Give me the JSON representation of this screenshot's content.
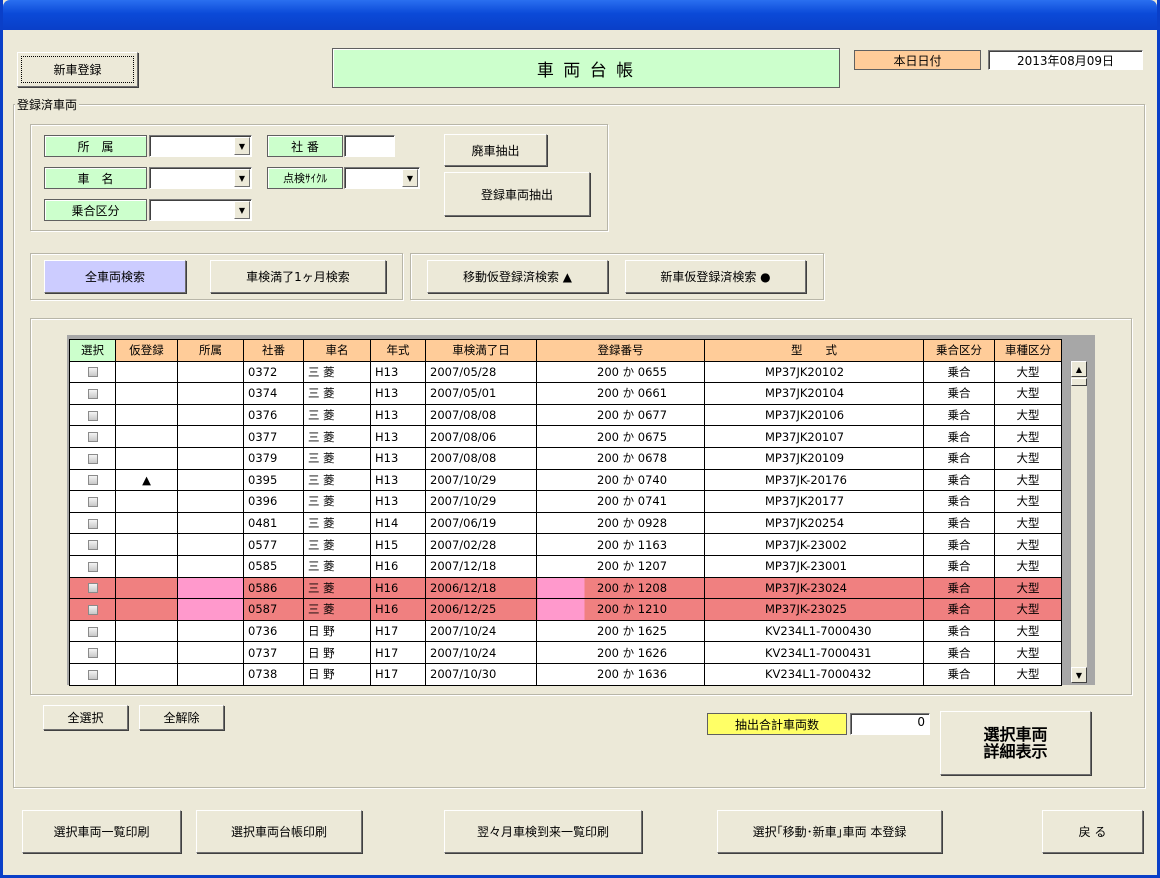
{
  "title": {
    "main": "車 両 台 帳",
    "today_label": "本日日付",
    "today_value": "2013年08月09日"
  },
  "buttons": {
    "new_car": "新車登録",
    "scrapped_extract": "廃車抽出",
    "registered_extract": "登録車両抽出",
    "all_search": "全車両検索",
    "inspection_month_search": "車検満了1ヶ月検索",
    "transfer_provisional_search": "移動仮登録済検索 ▲",
    "new_provisional_search": "新車仮登録済検索 ●",
    "select_all": "全選択",
    "deselect_all": "全解除",
    "detail_line1": "選択車両",
    "detail_line2": "詳細表示",
    "print_list": "選択車両一覧印刷",
    "print_ledger": "選択車両台帳印刷",
    "print_next_inspection": "翌々月車検到来一覧印刷",
    "register_selected": "選択｢移動･新車｣車両 本登録",
    "back": "戻 る"
  },
  "filters": {
    "group_caption": "登録済車両",
    "affiliation_label": "所　属",
    "car_name_label": "車　名",
    "riding_class_label": "乗合区分",
    "company_no_label": "社 番",
    "inspection_cycle_label": "点検ｻｲｸﾙ",
    "affiliation_value": "",
    "car_name_value": "",
    "riding_class_value": "",
    "company_no_value": "",
    "inspection_cycle_value": ""
  },
  "totals": {
    "label": "抽出合計車両数",
    "value": "0"
  },
  "grid": {
    "headers": [
      "選択",
      "仮登録",
      "所属",
      "社番",
      "車名",
      "年式",
      "車検満了日",
      "登録番号",
      "型　　式",
      "乗合区分",
      "車種区分"
    ],
    "rows": [
      {
        "prov": "",
        "no": "0372",
        "name": "三 菱",
        "year": "H13",
        "expiry": "2007/05/28",
        "reg": "200 か 0655",
        "model": "MP37JK20102",
        "riding": "乗合",
        "kind": "大型"
      },
      {
        "prov": "",
        "no": "0374",
        "name": "三 菱",
        "year": "H13",
        "expiry": "2007/05/01",
        "reg": "200 か 0661",
        "model": "MP37JK20104",
        "riding": "乗合",
        "kind": "大型"
      },
      {
        "prov": "",
        "no": "0376",
        "name": "三 菱",
        "year": "H13",
        "expiry": "2007/08/08",
        "reg": "200 か 0677",
        "model": "MP37JK20106",
        "riding": "乗合",
        "kind": "大型"
      },
      {
        "prov": "",
        "no": "0377",
        "name": "三 菱",
        "year": "H13",
        "expiry": "2007/08/06",
        "reg": "200 か 0675",
        "model": "MP37JK20107",
        "riding": "乗合",
        "kind": "大型"
      },
      {
        "prov": "",
        "no": "0379",
        "name": "三 菱",
        "year": "H13",
        "expiry": "2007/08/08",
        "reg": "200 か 0678",
        "model": "MP37JK20109",
        "riding": "乗合",
        "kind": "大型"
      },
      {
        "prov": "▲",
        "no": "0395",
        "name": "三 菱",
        "year": "H13",
        "expiry": "2007/10/29",
        "reg": "200 か 0740",
        "model": "MP37JK-20176",
        "riding": "乗合",
        "kind": "大型"
      },
      {
        "prov": "",
        "no": "0396",
        "name": "三 菱",
        "year": "H13",
        "expiry": "2007/10/29",
        "reg": "200 か 0741",
        "model": "MP37JK20177",
        "riding": "乗合",
        "kind": "大型"
      },
      {
        "prov": "",
        "no": "0481",
        "name": "三 菱",
        "year": "H14",
        "expiry": "2007/06/19",
        "reg": "200 か 0928",
        "model": "MP37JK20254",
        "riding": "乗合",
        "kind": "大型"
      },
      {
        "prov": "",
        "no": "0577",
        "name": "三 菱",
        "year": "H15",
        "expiry": "2007/02/28",
        "reg": "200 か 1163",
        "model": "MP37JK-23002",
        "riding": "乗合",
        "kind": "大型"
      },
      {
        "prov": "",
        "no": "0585",
        "name": "三 菱",
        "year": "H16",
        "expiry": "2007/12/18",
        "reg": "200 か 1207",
        "model": "MP37JK-23001",
        "riding": "乗合",
        "kind": "大型"
      },
      {
        "prov": "",
        "no": "0586",
        "name": "三 菱",
        "year": "H16",
        "expiry": "2006/12/18",
        "reg": "200 か 1208",
        "model": "MP37JK-23024",
        "riding": "乗合",
        "kind": "大型",
        "highlight": true
      },
      {
        "prov": "",
        "no": "0587",
        "name": "三 菱",
        "year": "H16",
        "expiry": "2006/12/25",
        "reg": "200 か 1210",
        "model": "MP37JK-23025",
        "riding": "乗合",
        "kind": "大型",
        "highlight": true
      },
      {
        "prov": "",
        "no": "0736",
        "name": "日 野",
        "year": "H17",
        "expiry": "2007/10/24",
        "reg": "200 か 1625",
        "model": "KV234L1-7000430",
        "riding": "乗合",
        "kind": "大型"
      },
      {
        "prov": "",
        "no": "0737",
        "name": "日 野",
        "year": "H17",
        "expiry": "2007/10/24",
        "reg": "200 か 1626",
        "model": "KV234L1-7000431",
        "riding": "乗合",
        "kind": "大型"
      },
      {
        "prov": "",
        "no": "0738",
        "name": "日 野",
        "year": "H17",
        "expiry": "2007/10/30",
        "reg": "200 か 1636",
        "model": "KV234L1-7000432",
        "riding": "乗合",
        "kind": "大型"
      }
    ]
  }
}
